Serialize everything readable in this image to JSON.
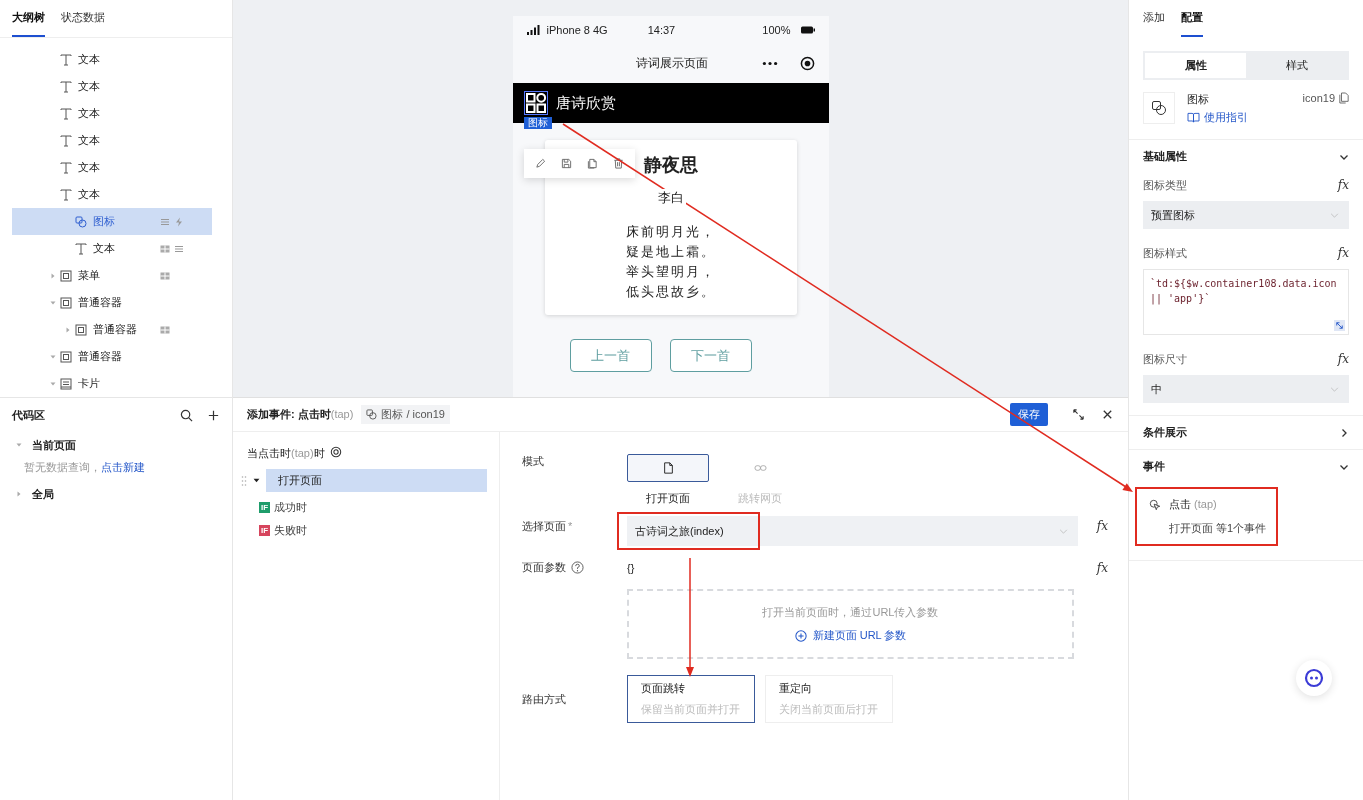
{
  "outline": {
    "tabs": [
      {
        "label": "大纲树",
        "selected": true
      },
      {
        "label": "状态数据",
        "selected": false
      }
    ],
    "nodes": [
      {
        "label": "文本",
        "kind": "text",
        "selected": false
      },
      {
        "label": "文本",
        "kind": "text",
        "selected": false
      },
      {
        "label": "文本",
        "kind": "text",
        "selected": false
      },
      {
        "label": "文本",
        "kind": "text",
        "selected": false
      },
      {
        "label": "文本",
        "kind": "text",
        "selected": false
      },
      {
        "label": "文本",
        "kind": "text",
        "selected": false,
        "children": [
          {
            "label": "图标",
            "kind": "icon",
            "selected": true,
            "badges": [
              {
                "kind": "list"
              },
              {
                "kind": "bolt"
              }
            ]
          },
          {
            "label": "文本",
            "kind": "text",
            "selected": false,
            "badges": [
              {
                "kind": "grid"
              },
              {
                "kind": "list"
              }
            ]
          }
        ]
      },
      {
        "label": "菜单",
        "kind": "box",
        "selected": false,
        "expanded": false,
        "badges": [
          {
            "kind": "grid"
          }
        ]
      },
      {
        "label": "普通容器",
        "kind": "box",
        "selected": false,
        "expanded": true,
        "children": [
          {
            "label": "普通容器",
            "kind": "box",
            "selected": false,
            "expanded": false,
            "badges": [
              {
                "kind": "grid"
              }
            ]
          }
        ]
      },
      {
        "label": "普通容器",
        "kind": "box",
        "selected": false,
        "expanded": true
      },
      {
        "label": "卡片",
        "kind": "card",
        "selected": false,
        "expanded": true
      }
    ]
  },
  "code_area": {
    "title": "代码区",
    "tree": [
      {
        "label": "当前页面",
        "expanded": true,
        "note": "暂无数据查询，",
        "link": "点击新建"
      },
      {
        "label": "全局",
        "expanded": false
      }
    ]
  },
  "canvas": {
    "status": {
      "carrier": "iPhone 8  4G",
      "time": "14:37",
      "battery": "100%"
    },
    "nav_title": "诗词展示页面",
    "header_title": "唐诗欣赏",
    "selection_tag": "图标",
    "poem": {
      "title": "静夜思",
      "author": "李白",
      "lines": [
        "床前明月光，",
        "疑是地上霜。",
        "举头望明月，",
        "低头思故乡。"
      ]
    },
    "buttons": [
      "上一首",
      "下一首"
    ]
  },
  "event_editor": {
    "title": "添加事件: 点击时",
    "trigger": "(tap)",
    "target": "图标 / icon19",
    "save": "保存",
    "when": {
      "before": "当点击时",
      "trigger": "(tap)",
      "after": "时"
    },
    "actions": [
      {
        "label": "打开页面",
        "expanded": true,
        "selected": true,
        "branches": [
          {
            "badge": "IF",
            "label": "成功时",
            "color": "#1f9d6b"
          },
          {
            "badge": "IF",
            "label": "失败时",
            "color": "#d6455d"
          }
        ]
      }
    ],
    "form": {
      "mode": {
        "label": "模式",
        "options": [
          {
            "label": "打开页面",
            "kind": "page",
            "selected": true
          },
          {
            "label": "跳转网页",
            "kind": "link",
            "selected": false
          }
        ]
      },
      "page": {
        "label": "选择页面",
        "required_mark": "*",
        "value": "古诗词之旅(index)",
        "fx": "fx"
      },
      "params": {
        "label": "页面参数",
        "value": "{}",
        "fx": "fx",
        "hint": "打开当前页面时，通过URL传入参数",
        "add": "新建页面 URL 参数"
      },
      "route": {
        "label": "路由方式",
        "options": [
          {
            "title": "页面跳转",
            "desc": "保留当前页面并打开",
            "selected": true
          },
          {
            "title": "重定向",
            "desc": "关闭当前页面后打开",
            "selected": false
          }
        ]
      }
    }
  },
  "inspector": {
    "tabs": [
      {
        "label": "添加",
        "selected": false
      },
      {
        "label": "配置",
        "selected": true
      }
    ],
    "segments": [
      {
        "label": "属性",
        "selected": true
      },
      {
        "label": "样式",
        "selected": false
      }
    ],
    "component": {
      "name": "图标",
      "guide": "使用指引",
      "id": "icon19"
    },
    "sections": [
      {
        "title": "基础属性",
        "expanded": true,
        "fields": [
          {
            "label": "图标类型",
            "fx": "fx",
            "kind": "select",
            "value": "预置图标"
          },
          {
            "label": "图标样式",
            "fx": "fx",
            "kind": "code",
            "value": "`td:${$w.container108.data.icon || 'app'}`"
          },
          {
            "label": "图标尺寸",
            "fx": "fx",
            "kind": "select",
            "value": "中"
          }
        ]
      },
      {
        "title": "条件展示",
        "expanded": false
      },
      {
        "title": "事件",
        "expanded": true,
        "events": [
          {
            "name": "点击",
            "trigger": "(tap)",
            "summary": "打开页面 等1个事件"
          }
        ]
      }
    ]
  }
}
